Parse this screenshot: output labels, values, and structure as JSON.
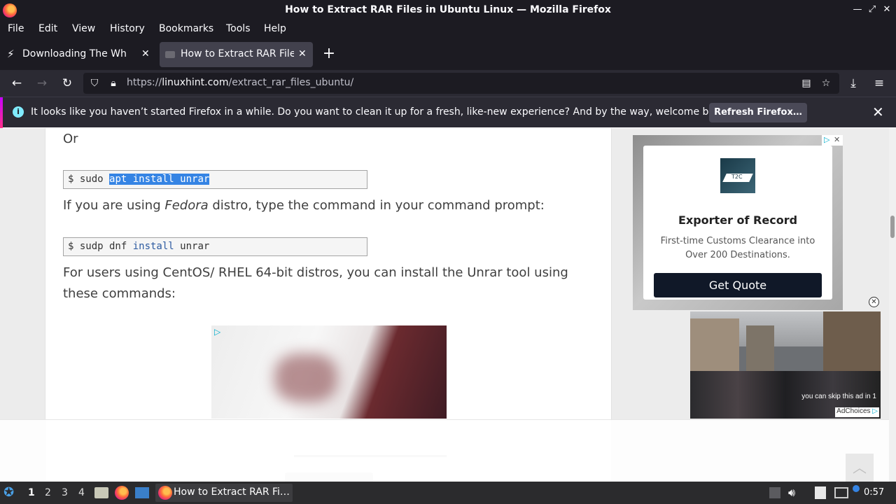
{
  "window": {
    "title": "How to Extract RAR Files in Ubuntu Linux — Mozilla Firefox"
  },
  "menu": [
    "File",
    "Edit",
    "View",
    "History",
    "Bookmarks",
    "Tools",
    "Help"
  ],
  "tabs": [
    {
      "label": "Downloading The White House",
      "active": false
    },
    {
      "label": "How to Extract RAR Files in Ubuntu Linux",
      "active": true
    }
  ],
  "url": {
    "protocol": "https://",
    "domain": "linuxhint.com",
    "path": "/extract_rar_files_ubuntu/"
  },
  "notification": {
    "message": "It looks like you haven’t started Firefox in a while. Do you want to clean it up for a fresh, like-new experience? And by the way, welcome back!",
    "button": "Refresh Firefox…"
  },
  "article": {
    "or": "Or",
    "cmd1_prefix": "$ sudo ",
    "cmd1_selected": "apt install unrar",
    "p_fedora_a": "If you are using ",
    "p_fedora_em": "Fedora",
    "p_fedora_b": " distro, type the command in your command prompt:",
    "cmd2_a": "$ sudp dnf ",
    "cmd2_kw": "install",
    "cmd2_b": " unrar",
    "p_centos": "For users using CentOS/ RHEL 64-bit distros, you can install the Unrar tool using these commands:"
  },
  "side_ad": {
    "logo_text": "T2C",
    "headline": "Exporter of Record",
    "subtext": "First-time Customs Clearance into Over 200 Destinations.",
    "cta": "Get Quote"
  },
  "video_ad": {
    "skip_text": "you can skip this ad in 1",
    "adchoices": "AdChoices"
  },
  "taskbar": {
    "workspaces": [
      "1",
      "2",
      "3",
      "4"
    ],
    "active_workspace": "1",
    "task_title": "How to Extract RAR Fi…",
    "clock": "0:57"
  }
}
